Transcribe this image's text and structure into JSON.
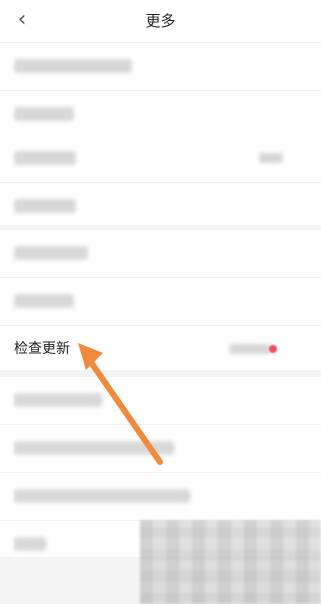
{
  "header": {
    "back_icon": "‹",
    "title": "更多"
  },
  "sections": [
    {
      "rows": [
        {
          "label": ""
        },
        {
          "label": ""
        }
      ]
    },
    {
      "rows": [
        {
          "label": ""
        },
        {
          "label": ""
        }
      ]
    },
    {
      "rows": [
        {
          "label": ""
        },
        {
          "label": ""
        },
        {
          "label": "检查更新"
        }
      ]
    },
    {
      "rows": [
        {
          "label": ""
        },
        {
          "label": ""
        },
        {
          "label": ""
        },
        {
          "label": ""
        }
      ]
    }
  ],
  "annotation": {
    "arrow_color": "#f08a3c"
  },
  "colors": {
    "background": "#f4f4f4",
    "card": "#ffffff",
    "badge_red": "#f24a5c"
  }
}
